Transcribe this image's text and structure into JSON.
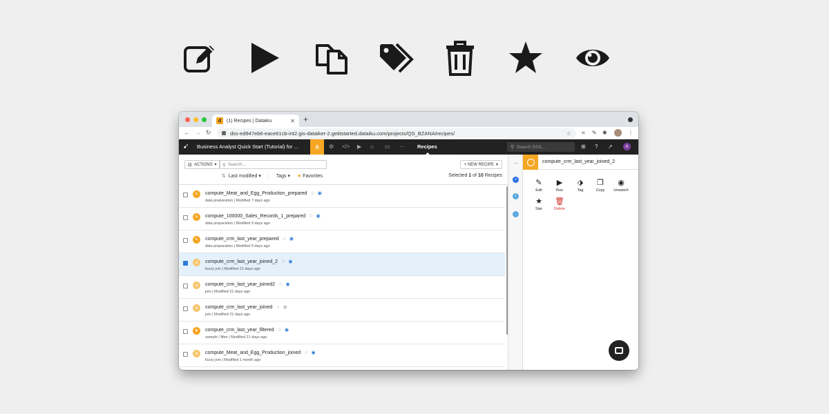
{
  "icon_strip": [
    "edit-icon",
    "run-icon",
    "copy-icon",
    "tag-icon",
    "delete-icon",
    "star-icon",
    "watch-icon"
  ],
  "browser": {
    "tab_title": "(1) Recipes | Dataiku",
    "favicon_letter": "d",
    "url": "dss-ed947eb6-eace61cb-int2.gis-dataiker-2.getitstarted.dataiku.com/projects/QS_BZANA/recipes/"
  },
  "dss_nav": {
    "project_name": "Business Analyst Quick Start (Tutorial) for ...",
    "current_section": "Recipes",
    "search_placeholder": "Search DSS...",
    "avatar_letter": "A"
  },
  "toolbar": {
    "actions_label": "ACTIONS",
    "search_placeholder": "Search...",
    "new_recipe_label": "+ NEW RECIPE",
    "sort_label": "Last modified",
    "tags_label": "Tags",
    "favorites_label": "Favorites",
    "selected_prefix": "Selected",
    "selected_count": "1",
    "selected_of": "of",
    "total_count": "10",
    "selected_suffix": "Recipes"
  },
  "recipes": [
    {
      "name": "compute_Meat_and_Egg_Production_prepared",
      "meta": "data preparation | Modified 7 days ago",
      "checked": false
    },
    {
      "name": "compute_100000_Sales_Records_1_prepared",
      "meta": "data preparation | Modified 9 days ago",
      "checked": false
    },
    {
      "name": "compute_crm_last_year_prepared",
      "meta": "data preparation | Modified 9 days ago",
      "checked": false
    },
    {
      "name": "compute_crm_last_year_joined_2",
      "meta": "fuzzy join | Modified 21 days ago",
      "checked": true
    },
    {
      "name": "compute_crm_last_year_joined2",
      "meta": "join | Modified 21 days ago",
      "checked": false
    },
    {
      "name": "compute_crm_last_year_joined",
      "meta": "join | Modified 21 days ago",
      "checked": false
    },
    {
      "name": "compute_crm_last_year_filtered",
      "meta": "sample / filter | Modified 21 days ago",
      "checked": false
    },
    {
      "name": "compute_Meat_and_Egg_Production_joined",
      "meta": "fuzzy join | Modified 1 month ago",
      "checked": false
    }
  ],
  "panel": {
    "title": "compute_crm_last_year_joined_2",
    "actions": {
      "edit": "Edit",
      "run": "Run",
      "tag": "Tag",
      "copy": "Copy",
      "unwatch": "Unwatch",
      "star": "Star",
      "delete": "Delete"
    }
  },
  "colors": {
    "accent": "#f5a623",
    "selected_row": "#e4f1fb",
    "link_blue": "#2b7bd6",
    "delete_red": "#d0342c"
  }
}
